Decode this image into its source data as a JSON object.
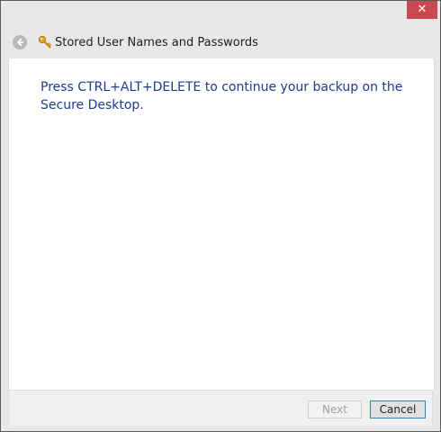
{
  "window": {
    "title": "Stored User Names and Passwords",
    "close_label": "✕"
  },
  "icons": {
    "back": "back-arrow-icon",
    "app": "key-icon",
    "close": "close-icon"
  },
  "content": {
    "message": "Press CTRL+ALT+DELETE to continue your backup on the Secure Desktop."
  },
  "footer": {
    "next_label": "Next",
    "next_enabled": false,
    "cancel_label": "Cancel"
  },
  "colors": {
    "message_text": "#1d3c8f",
    "close_button": "#c74b50",
    "focus_border": "#3c7fb1"
  }
}
